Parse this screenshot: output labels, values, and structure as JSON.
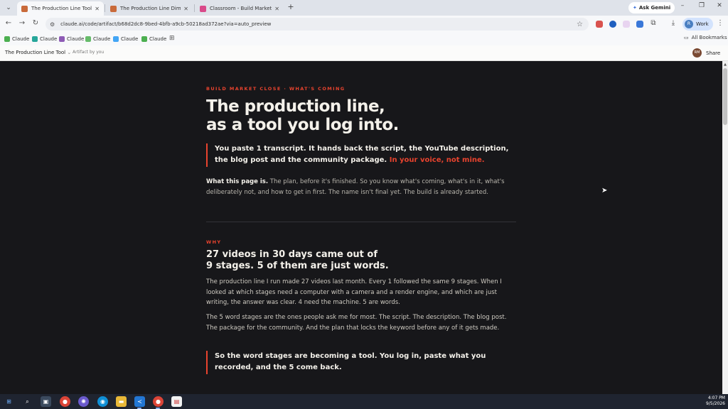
{
  "browser": {
    "tabs": [
      {
        "title": "The Production Line Tool",
        "active": true,
        "favicon_color": "#c96a3a"
      },
      {
        "title": "The Production Line Dime Sale",
        "active": false,
        "favicon_color": "#c96a3a"
      },
      {
        "title": "Classroom - Build Market Close",
        "active": false,
        "favicon_color": "#d94a8a"
      }
    ],
    "new_tab": "+",
    "ask_gemini": "Ask Gemini",
    "url": "claude.ai/code/artifact/b68d2dc8-9bed-4bfb-a9cb-50218ad372ae?via=auto_preview",
    "profile_label": "Work",
    "bookmarks": [
      {
        "label": "Claude",
        "color": "#4caf50"
      },
      {
        "label": "Claude",
        "color": "#26a69a"
      },
      {
        "label": "Claude",
        "color": "#8e5bb5"
      },
      {
        "label": "Claude",
        "color": "#66bb6a"
      },
      {
        "label": "Claude",
        "color": "#42a5f5"
      },
      {
        "label": "Claude",
        "color": "#4caf50"
      }
    ],
    "all_bookmarks": "All Bookmarks"
  },
  "artifact_header": {
    "title": "The Production Line Tool",
    "subtitle": "Artifact by you",
    "avatar_initials": "RM",
    "share_label": "Share"
  },
  "page": {
    "eyebrow_top": "BUILD MARKET CLOSE · WHAT'S COMING",
    "title_line1": "The production line,",
    "title_line2": "as a tool you log into.",
    "lead_main": "You paste 1 transcript. It hands back the script, the YouTube description, the blog post and the community package.",
    "lead_accent": "In your voice, not mine.",
    "what_label": "What this page is.",
    "what_text": "The plan, before it's finished. So you know what's coming, what's in it, what's deliberately not, and how to get in first. The name isn't final yet. The build is already started.",
    "eyebrow_why": "WHY",
    "why_title_line1": "27 videos in 30 days came out of",
    "why_title_line2": "9 stages. 5 of them are just words.",
    "why_p1": "The production line I run made 27 videos last month. Every 1 followed the same 9 stages. When I looked at which stages need a computer with a camera and a render engine, and which are just writing, the answer was clear. 4 need the machine. 5 are words.",
    "why_p2": "The 5 word stages are the ones people ask me for most. The script. The description. The blog post. The package for the community. And the plan that locks the keyword before any of it gets made.",
    "why_quote": "So the word stages are becoming a tool. You log in, paste what you recorded, and the 5 come back."
  },
  "taskbar": {
    "time": "4:07 PM",
    "date": "9/5/2026"
  },
  "colors": {
    "accent": "#e8432e",
    "page_bg": "#17171a",
    "heading": "#f4f1ea"
  }
}
